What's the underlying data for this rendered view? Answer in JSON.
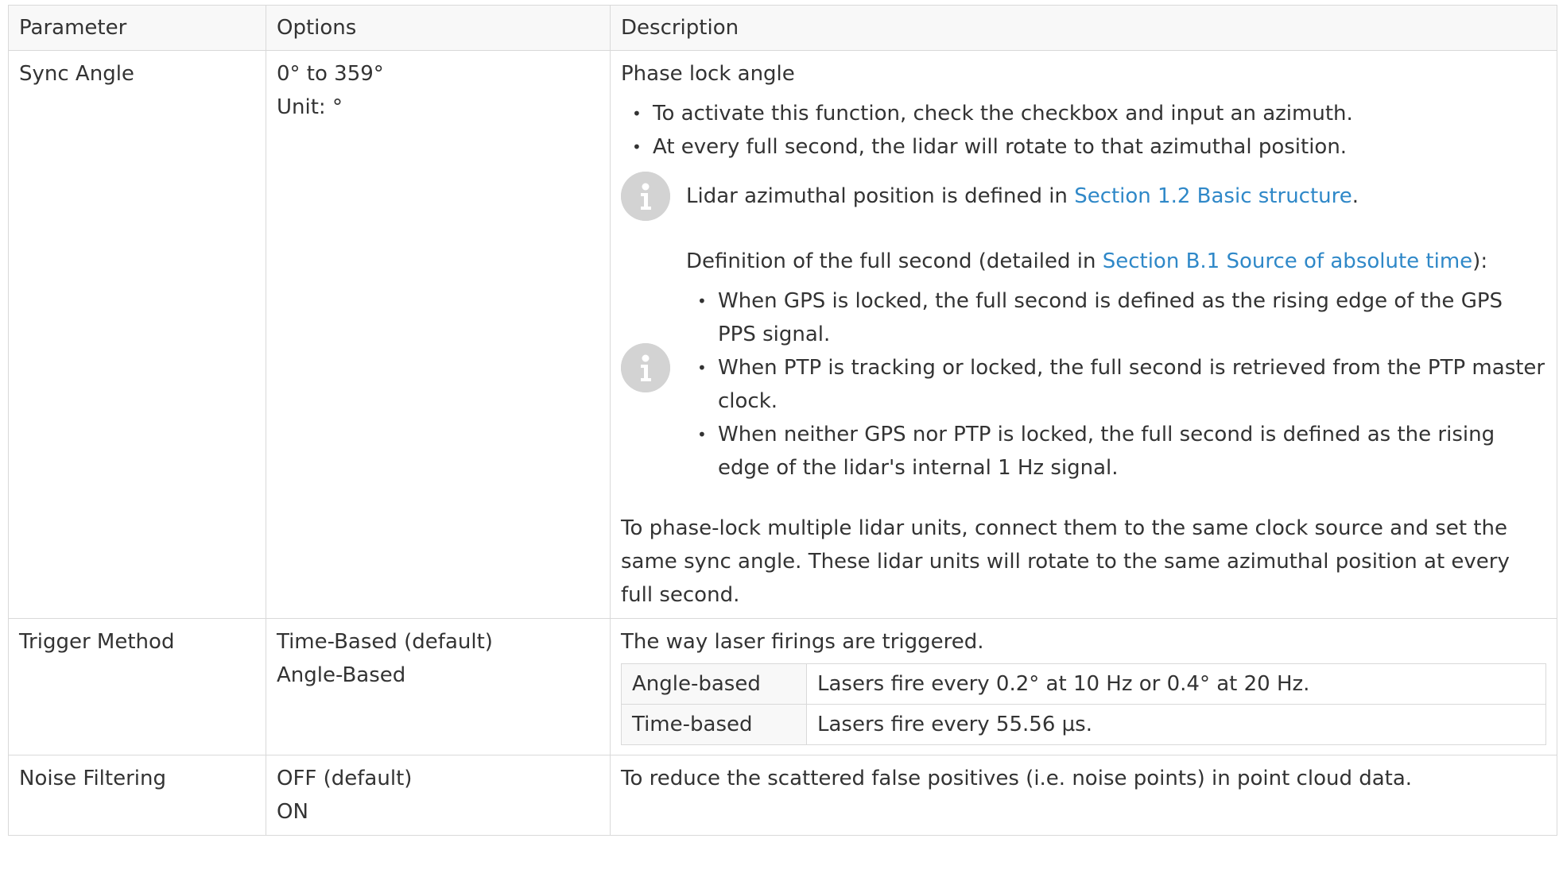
{
  "headers": {
    "parameter": "Parameter",
    "options": "Options",
    "description": "Description"
  },
  "rows": {
    "sync": {
      "param": "Sync Angle",
      "opt1": "0° to 359°",
      "opt2": "Unit: °",
      "title": "Phase lock angle",
      "bullets": [
        "To activate this function, check the checkbox and input an azimuth.",
        "At every full second, the lidar will rotate to that azimuthal position."
      ],
      "note1": {
        "before": "Lidar azimuthal position is defined in ",
        "link": "Section 1.2 Basic structure",
        "after": "."
      },
      "note2": {
        "before": "Definition of the full second (detailed in ",
        "link": "Section B.1 Source of absolute time",
        "after": "):",
        "bullets": [
          "When GPS is locked, the full second is defined as the rising edge of the GPS PPS signal.",
          "When PTP is tracking or locked, the full second is retrieved from the PTP master clock.",
          "When neither GPS nor PTP is locked, the full second is defined as the rising edge of the lidar's internal 1 Hz signal."
        ]
      },
      "para": "To phase-lock multiple lidar units, connect them to the same clock source and set the same sync angle. These lidar units will rotate to the same azimuthal position at every full second."
    },
    "trigger": {
      "param": "Trigger Method",
      "opt1": "Time-Based (default)",
      "opt2": "Angle-Based",
      "desc": "The way laser firings are triggered.",
      "table": [
        {
          "k": "Angle-based",
          "v": "Lasers fire every 0.2° at 10 Hz or 0.4° at 20 Hz."
        },
        {
          "k": "Time-based",
          "v": "Lasers fire every 55.56 µs."
        }
      ]
    },
    "noise": {
      "param": "Noise Filtering",
      "opt1": "OFF (default)",
      "opt2": "ON",
      "desc": "To reduce the scattered false positives (i.e. noise points) in point cloud data."
    }
  },
  "icons": {
    "note": "info-icon"
  },
  "colors": {
    "link": "#2f88c8",
    "icon_bg": "#d3d3d3",
    "border": "#d9d9d9"
  }
}
